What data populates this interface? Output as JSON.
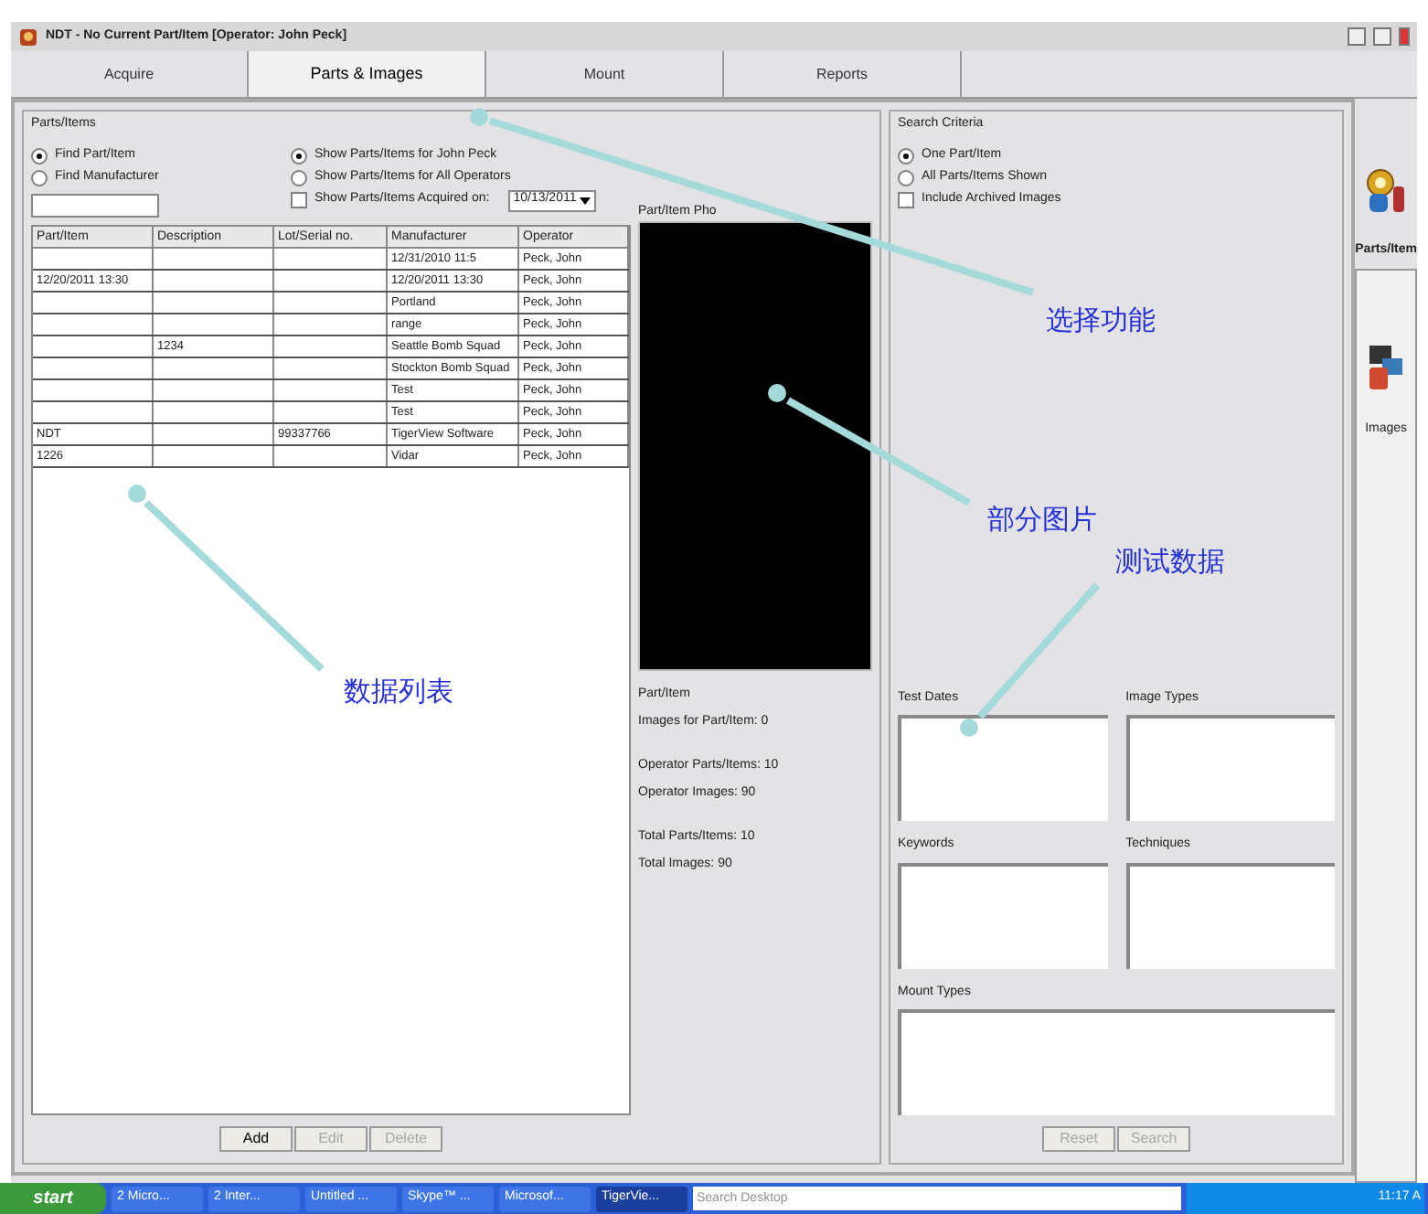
{
  "window": {
    "title": "NDT - No Current Part/Item [Operator: John Peck]"
  },
  "tabs": [
    {
      "label": "Acquire",
      "selected": false
    },
    {
      "label": "Parts & Images",
      "selected": true
    },
    {
      "label": "Mount",
      "selected": false
    },
    {
      "label": "Reports",
      "selected": false
    }
  ],
  "parts_group": {
    "title": "Parts/Items",
    "find_options": [
      {
        "label": "Find Part/Item",
        "selected": true
      },
      {
        "label": "Find Manufacturer",
        "selected": false
      }
    ],
    "show_options": [
      {
        "kind": "radio",
        "label": "Show Parts/Items for John Peck",
        "selected": true
      },
      {
        "kind": "radio",
        "label": "Show Parts/Items for All Operators",
        "selected": false
      },
      {
        "kind": "checkbox",
        "label": "Show Parts/Items Acquired on:",
        "checked": false
      }
    ],
    "date_field": {
      "value": "10/13/2011"
    },
    "table": {
      "columns": [
        "Part/Item",
        "Description",
        "Lot/Serial no.",
        "Manufacturer",
        "Operator"
      ],
      "rows": [
        [
          "",
          "",
          "",
          "12/31/2010 11:5",
          "Peck, John"
        ],
        [
          "12/20/2011 13:30",
          "",
          "",
          "12/20/2011 13:30",
          "Peck, John"
        ],
        [
          "",
          "",
          "",
          "Portland",
          "Peck, John"
        ],
        [
          "",
          "",
          "",
          "range",
          "Peck, John"
        ],
        [
          "",
          "1234",
          "",
          "Seattle Bomb Squad",
          "Peck, John"
        ],
        [
          "",
          "",
          "",
          "Stockton Bomb Squad",
          "Peck, John"
        ],
        [
          "",
          "",
          "",
          "Test",
          "Peck, John"
        ],
        [
          "",
          "",
          "",
          "Test",
          "Peck, John"
        ],
        [
          "NDT",
          "",
          "99337766",
          "TigerView Software",
          "Peck, John"
        ],
        [
          "1226",
          "",
          "",
          "Vidar",
          "Peck, John"
        ]
      ]
    },
    "buttons": [
      {
        "label": "Add",
        "disabled": false
      },
      {
        "label": "Edit",
        "disabled": true
      },
      {
        "label": "Delete",
        "disabled": true
      }
    ],
    "photo_label": "Part/Item Pho",
    "stats": [
      [
        "Part/Item",
        "Images for Part/Item: 0"
      ],
      [
        "Operator Parts/Items: 10",
        "Operator Images: 90"
      ],
      [
        "Total Parts/Items: 10",
        "Total Images: 90"
      ]
    ]
  },
  "search_group": {
    "title": "Search Criteria",
    "options": [
      {
        "kind": "radio",
        "label": "One Part/Item",
        "selected": true
      },
      {
        "kind": "radio",
        "label": "All Parts/Items Shown",
        "selected": false
      },
      {
        "kind": "checkbox",
        "label": "Include Archived Images",
        "checked": false
      }
    ],
    "lists": [
      {
        "label": "Test Dates"
      },
      {
        "label": "Image Types"
      },
      {
        "label": "Keywords"
      },
      {
        "label": "Techniques"
      },
      {
        "label": "Mount Types"
      }
    ],
    "buttons": [
      {
        "label": "Reset",
        "disabled": true
      },
      {
        "label": "Search",
        "disabled": true
      }
    ]
  },
  "sidebar": {
    "label": "Parts/Item",
    "button": "Images"
  },
  "annotations": [
    "选择功能",
    "部分图片",
    "测试数据",
    "数据列表"
  ],
  "taskbar": {
    "start": "start",
    "items": [
      {
        "label": "2 Micro...",
        "selected": false
      },
      {
        "label": "2 Inter...",
        "selected": false
      },
      {
        "label": "Untitled ...",
        "selected": false
      },
      {
        "label": "Skype™ ...",
        "selected": false
      },
      {
        "label": "Microsof...",
        "selected": false
      },
      {
        "label": "TigerVie...",
        "selected": true
      }
    ],
    "search": {
      "placeholder": "Search Desktop"
    },
    "clock": "11:17 A"
  }
}
